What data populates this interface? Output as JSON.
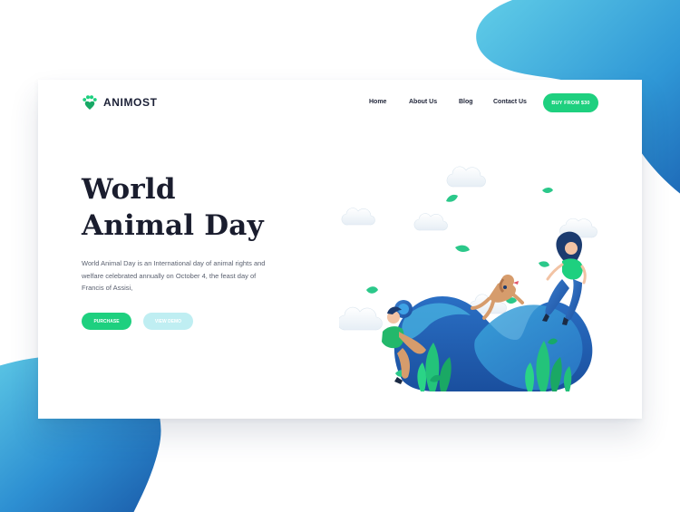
{
  "brand": {
    "name": "ANIMOST",
    "logo_icon": "paw-heart-icon",
    "accent": "#1ed07f"
  },
  "nav": {
    "items": [
      {
        "label": "Home"
      },
      {
        "label": "About Us"
      },
      {
        "label": "Blog"
      },
      {
        "label": "Contact Us"
      }
    ],
    "cta_label": "BUY FROM $30"
  },
  "hero": {
    "title_line1": "World",
    "title_line2": "Animal Day",
    "description": "World Animal Day is an International day of animal rights and welfare celebrated annually on October 4, the feast day of Francis of Assisi,",
    "purchase_label": "PURCHASE",
    "demo_label": "VIEW DEMO"
  },
  "colors": {
    "green": "#1ed07f",
    "light_cyan": "#bfeef2",
    "blob_light": "#5cc8e6",
    "blob_dark": "#1b62b3",
    "heading": "#1a1d2e"
  },
  "illustration": {
    "icons": [
      "boy-with-frisbee",
      "dog-jumping",
      "girl-floating",
      "cloud-icon",
      "leaf-icon",
      "hill-shape",
      "plant-icon"
    ]
  }
}
